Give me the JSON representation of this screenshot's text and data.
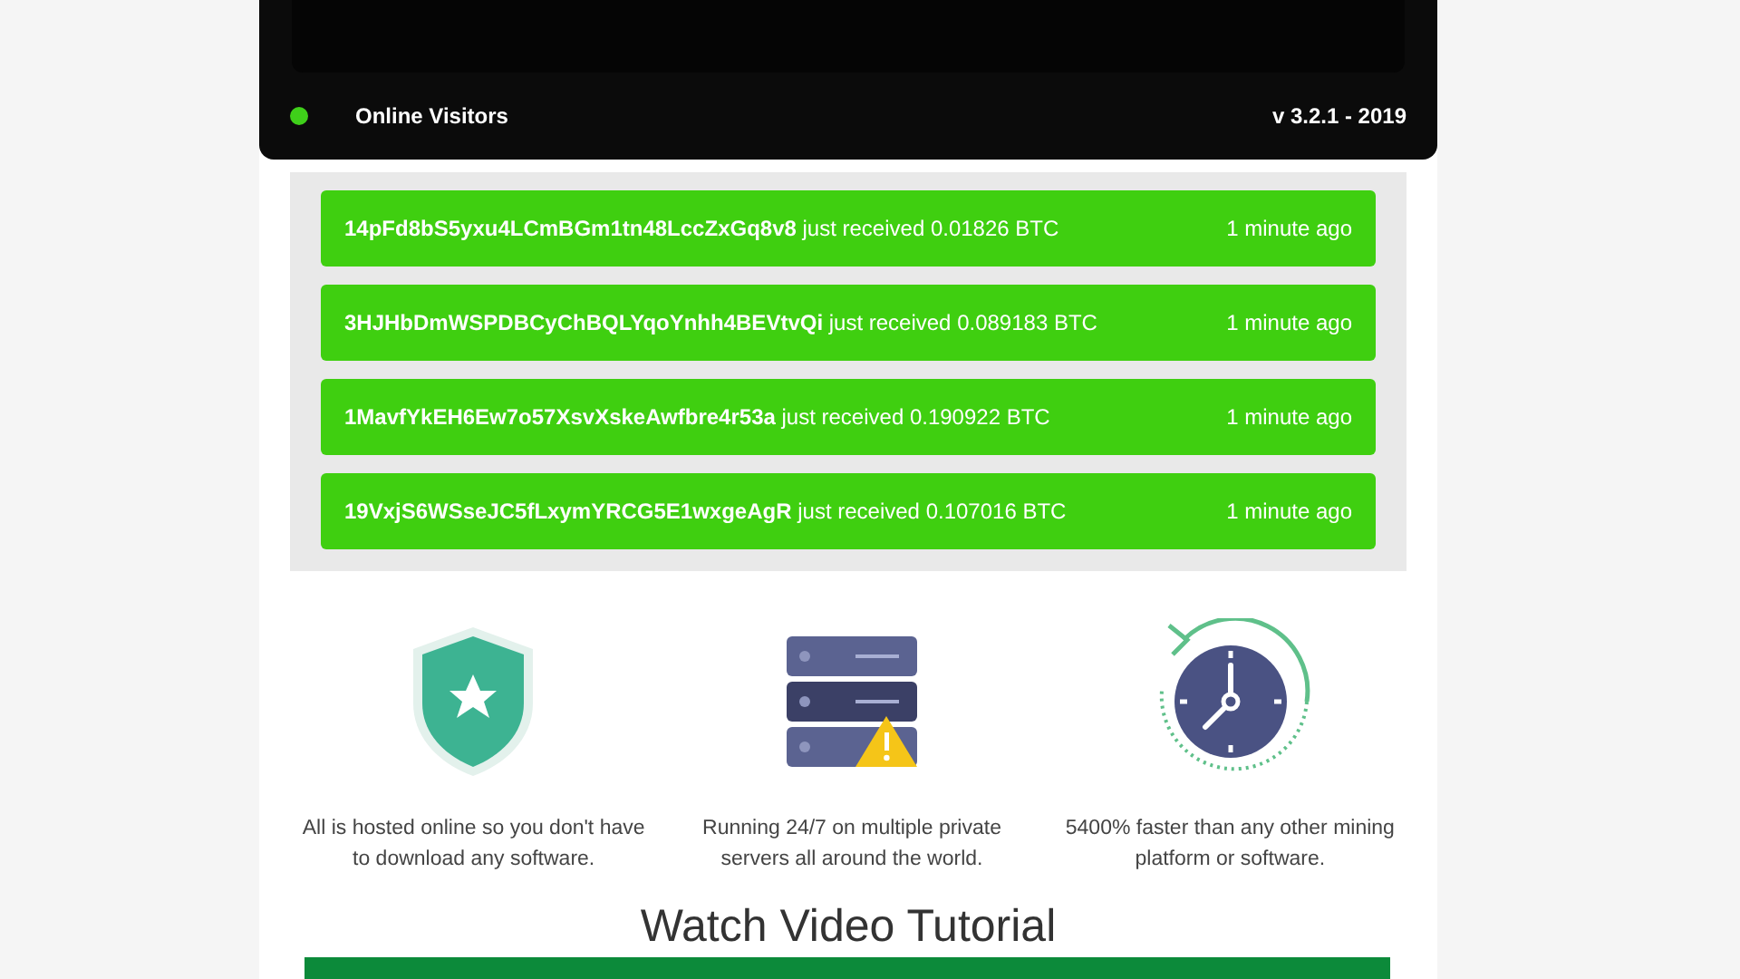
{
  "status_bar": {
    "online": true,
    "label": "Online Visitors",
    "version": "v 3.2.1 - 2019"
  },
  "payouts": [
    {
      "address": "14pFd8bS5yxu4LCmBGm1tn48LccZxGq8v8",
      "message": "just received 0.01826 BTC",
      "time": "1 minute ago"
    },
    {
      "address": "3HJHbDmWSPDBCyChBQLYqoYnhh4BEVtvQi",
      "message": "just received 0.089183 BTC",
      "time": "1 minute ago"
    },
    {
      "address": "1MavfYkEH6Ew7o57XsvXskeAwfbre4r53a",
      "message": "just received 0.190922 BTC",
      "time": "1 minute ago"
    },
    {
      "address": "19VxjS6WSseJC5fLxymYRCG5E1wxgeAgR",
      "message": "just received 0.107016 BTC",
      "time": "1 minute ago"
    }
  ],
  "features": [
    {
      "kind": "shield",
      "text": "All is hosted online so you don't have to download any software."
    },
    {
      "kind": "server",
      "text": "Running 24/7 on multiple private servers all around the world."
    },
    {
      "kind": "clock",
      "text": "5400% faster than any other mining platform or software."
    }
  ],
  "video_section": {
    "title": "Watch Video Tutorial"
  }
}
